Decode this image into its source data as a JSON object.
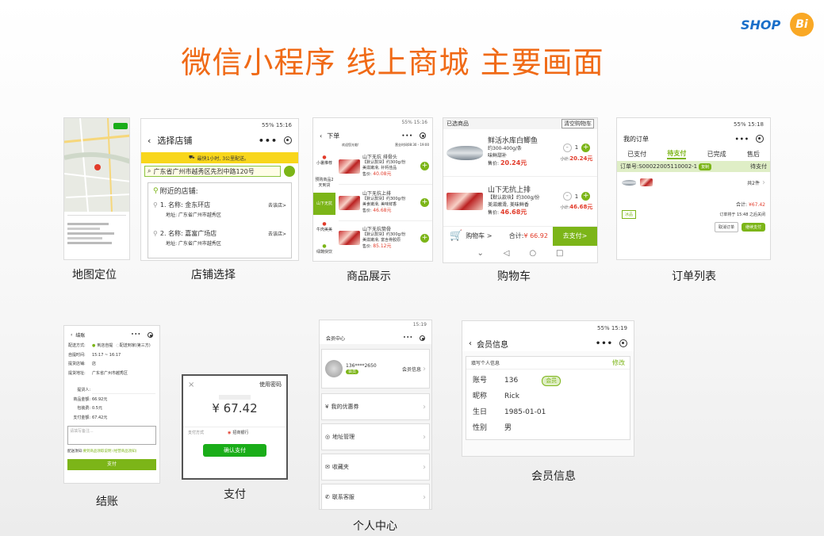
{
  "page_title": "微信小程序 线上商城 主要画面",
  "logo": {
    "text": "SHOP",
    "bi": "Bi",
    "brand_color": "#1a6fc9",
    "accent": "#f9a825"
  },
  "colors": {
    "title": "#f06a16",
    "primary_green": "#7cb518",
    "price_red": "#e23c2b"
  },
  "captions": {
    "map": "地图定位",
    "store": "店铺选择",
    "products": "商品展示",
    "cart": "购物车",
    "orders": "订单列表",
    "checkout": "结账",
    "payment": "支付",
    "profile": "个人中心",
    "member": "会员信息"
  },
  "store": {
    "status": "55% 15:16",
    "title": "选择店铺",
    "delivery_hint": "最快1小时, 3公里配送。",
    "address": "广东省广州市越秀区先烈中路120号",
    "nearby_label": "附近的店铺:",
    "items": [
      {
        "name": "1. 名称: 金东环店",
        "addr": "地址: 广东省广州市越秀区",
        "link": "去该店>"
      },
      {
        "name": "2. 名称: 嘉富广场店",
        "addr": "地址: 广东省广州市越秀区",
        "link": "去该店>"
      }
    ]
  },
  "products": {
    "status": "55% 15:16",
    "title": "下单",
    "banner_left": "欢迎您光临!",
    "banner_right": "营业时间08:30 - 19:00",
    "categories": [
      "小暑推荐",
      "预购商品2天到货",
      "山下无抗",
      "牛肉美美",
      "绿蔬快饮"
    ],
    "items": [
      {
        "name": "山下无抗 排骨头",
        "desc": "【默认款块】约300g/份",
        "desc2": "美滋嫩滑, 补钙佳品",
        "price_label": "售价:",
        "price": "40.08元"
      },
      {
        "name": "山下无抗上排",
        "desc": "【默认款块】约300g/份",
        "desc2": "美食嫩滑, 美味鲜香",
        "price_label": "售价:",
        "price": "46.68元"
      },
      {
        "name": "山下无抗筒骨",
        "desc": "【默认款块】约300g/份",
        "desc2": "美滋嫩滑, 富含骨胶原",
        "price_label": "售价:",
        "price": "85.12元"
      }
    ]
  },
  "cart": {
    "header_left": "已选商品",
    "header_right": "清空购物车",
    "items": [
      {
        "name": "鲜活水库白鲫鱼",
        "spec": "约300-400g/条",
        "desc": "味鲜甜补",
        "price_label": "售价:",
        "price": "20.24元",
        "qty": "1",
        "subtotal_label": "小计:",
        "subtotal": "20.24元"
      },
      {
        "name": "山下无抗上排",
        "spec": "【默认款块】约300g/份",
        "desc": "美滋嫩滑, 美味鲜香",
        "price_label": "售价:",
        "price": "46.68元",
        "qty": "1",
        "subtotal_label": "小计:",
        "subtotal": "46.68元"
      }
    ],
    "cart_label": "购物车 >",
    "total_label": "合计:",
    "total": "¥ 66.92",
    "pay_button": "去支付>"
  },
  "orders": {
    "status": "55% 15:18",
    "title": "我的订单",
    "tabs": [
      "已支付",
      "待支付",
      "已完成",
      "售后"
    ],
    "active_tab": 1,
    "order_no": "订单号:S00022005110002-1",
    "copy": "复制",
    "state": "待支付",
    "count": "共2件",
    "total_label": "合计:",
    "total": "¥67.42",
    "tag": "冰品",
    "deadline": "订单将于 15:48 之后关闭",
    "cancel": "取消订单",
    "continue": "继续支付"
  },
  "checkout": {
    "title": "结账",
    "rows": [
      {
        "label": "配送方式:",
        "value": "到店自提",
        "extra": "配送到家(第三方)"
      },
      {
        "label": "自提时间:",
        "value": "15:17 ~ 16:17"
      },
      {
        "label": "提货店铺:",
        "value": "店"
      },
      {
        "label": "提货地址:",
        "value": "广东省广州市越秀区"
      },
      {
        "label": "提货人:",
        "value": ""
      },
      {
        "label": "商品金额:",
        "value": "66.92元"
      },
      {
        "label": "包装费:",
        "value": "0.5元"
      },
      {
        "label": "支付金额:",
        "value": "67.42元"
      }
    ],
    "note_placeholder": "请填写备注...",
    "notice_label": "配送须知:",
    "notice_link": "要到商品领取说明 (经营商品须知)",
    "pay_button": "支付"
  },
  "payment": {
    "close": "×",
    "use_password": "使用密码",
    "amount": "¥ 67.42",
    "method_label": "支付方式",
    "method_value": "招商银行",
    "confirm": "确认支付"
  },
  "profile": {
    "status": "15:19",
    "title": "会员中心",
    "phone": "136****2650",
    "badge": "会员",
    "info_link": "会员信息",
    "menu": [
      {
        "label": "我的优惠券",
        "icon": "coupon-icon"
      },
      {
        "label": "地址管理",
        "icon": "location-icon"
      },
      {
        "label": "收藏夹",
        "icon": "mail-icon"
      },
      {
        "label": "联系客服",
        "icon": "phone-icon"
      }
    ]
  },
  "member": {
    "status": "55% 15:19",
    "title": "会员信息",
    "section": "填写个人信息",
    "edit": "修改",
    "badge": "会员",
    "fields": [
      {
        "label": "账号",
        "value": "136"
      },
      {
        "label": "昵称",
        "value": "Rick"
      },
      {
        "label": "生日",
        "value": "1985-01-01"
      },
      {
        "label": "性别",
        "value": "男"
      }
    ]
  }
}
